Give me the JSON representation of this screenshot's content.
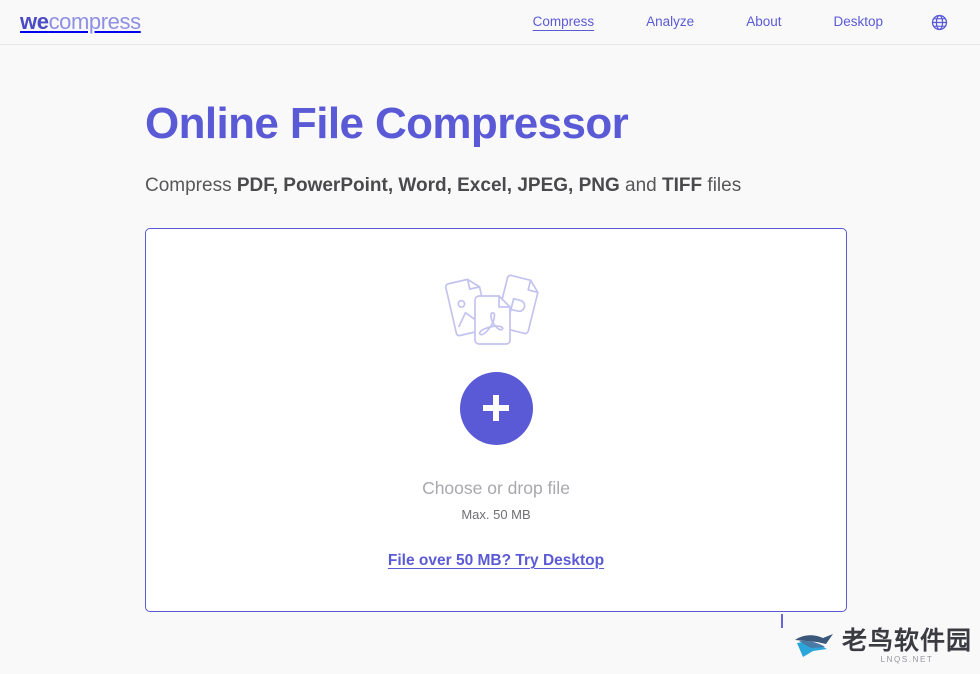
{
  "header": {
    "logo": {
      "primary": "we",
      "secondary": "compress"
    },
    "nav": [
      {
        "label": "Compress",
        "active": true
      },
      {
        "label": "Analyze",
        "active": false
      },
      {
        "label": "About",
        "active": false
      },
      {
        "label": "Desktop",
        "active": false
      }
    ],
    "language_icon": "globe-icon"
  },
  "main": {
    "title": "Online File Compressor",
    "subtitle": {
      "lead": "Compress ",
      "formats": "PDF, PowerPoint, Word, Excel, JPEG, PNG",
      "conjunction": " and ",
      "last_format": "TIFF",
      "trail": " files"
    },
    "dropzone": {
      "illustration": "documents-illustration",
      "add_button_icon": "plus-icon",
      "choose_text": "Choose or drop file",
      "max_size_text": "Max. 50 MB",
      "desktop_link": "File over 50 MB? Try Desktop"
    }
  },
  "watermark": {
    "title": "老鸟软件园",
    "subtitle": "LNQS.NET",
    "logo_icon": "bird-logo-icon"
  },
  "colors": {
    "accent": "#5b5ad6",
    "logo_dark": "#4b4bc4",
    "logo_light": "#8f8fe3",
    "illustration": "#c3c3f0",
    "page_bg": "#f9f9fa",
    "panel_bg": "#ffffff",
    "muted_text": "#a8a8ad"
  }
}
